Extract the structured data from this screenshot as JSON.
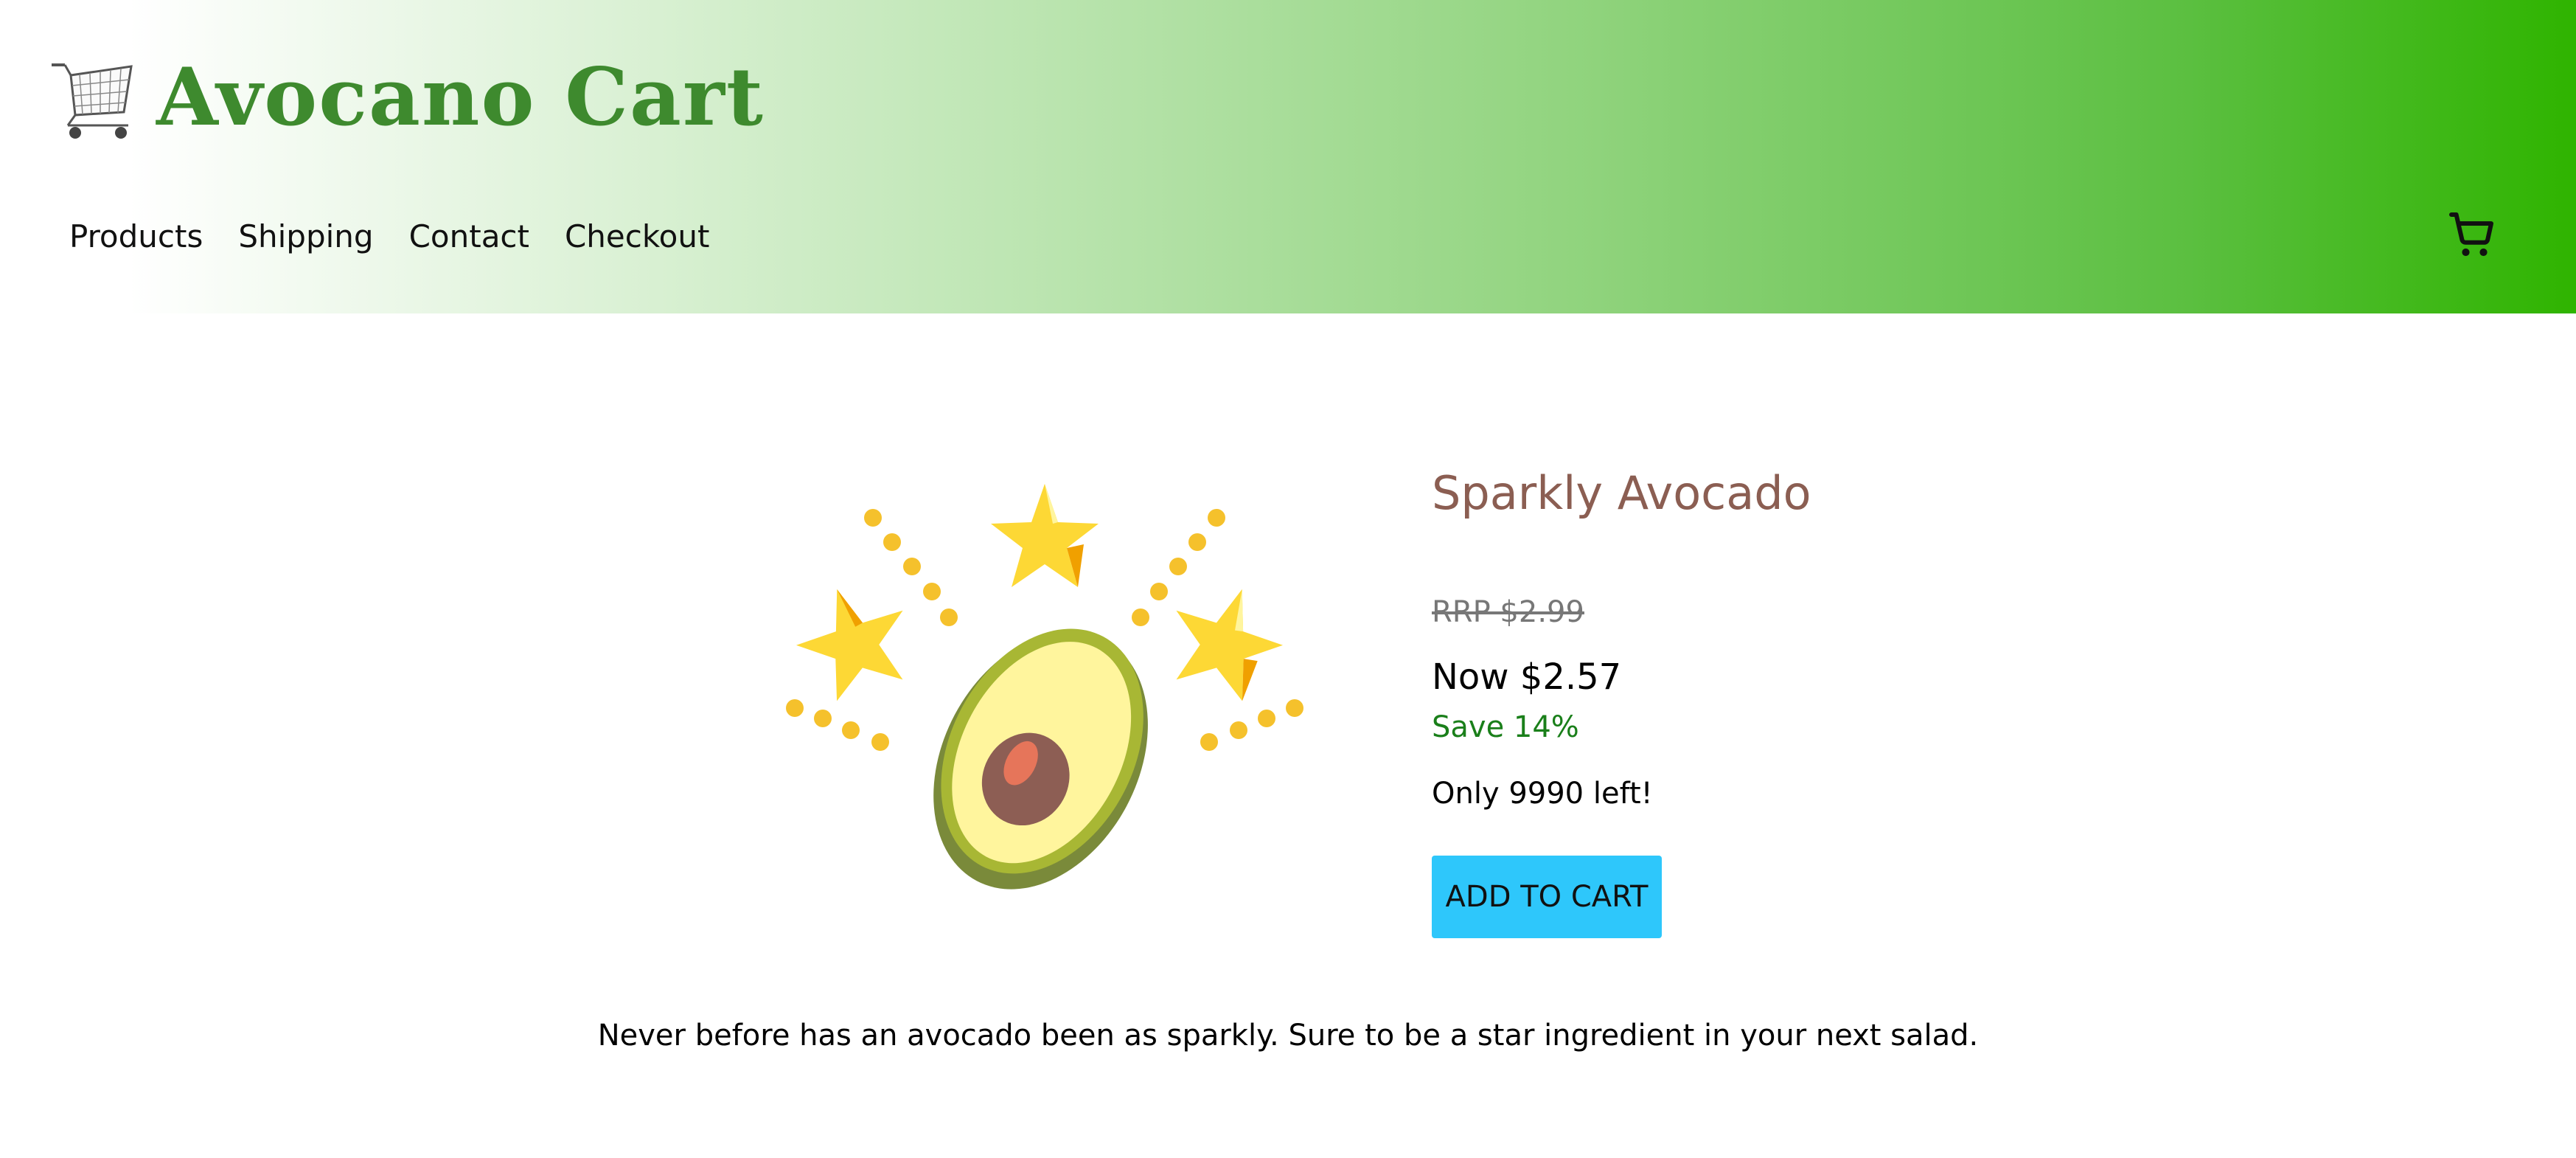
{
  "brand": {
    "name": "Avocano Cart",
    "text_color": "#3e8a2e"
  },
  "nav": {
    "items": [
      "Products",
      "Shipping",
      "Contact",
      "Checkout"
    ]
  },
  "header": {
    "gradient_end_color": "#2fb400"
  },
  "product": {
    "title": "Sparkly Avocado",
    "rrp": "RRP $2.99",
    "now": "Now $2.57",
    "save": "Save 14%",
    "stock": "Only 9990 left!",
    "add_to_cart": "ADD TO CART",
    "description": "Never before has an avocado been as sparkly. Sure to be a star ingredient in your next salad.",
    "image_icon": "sparkly-avocado-icon"
  },
  "colors": {
    "title": "#8b5e52",
    "save": "#1a7f1a",
    "button": "#2ec7fb"
  }
}
